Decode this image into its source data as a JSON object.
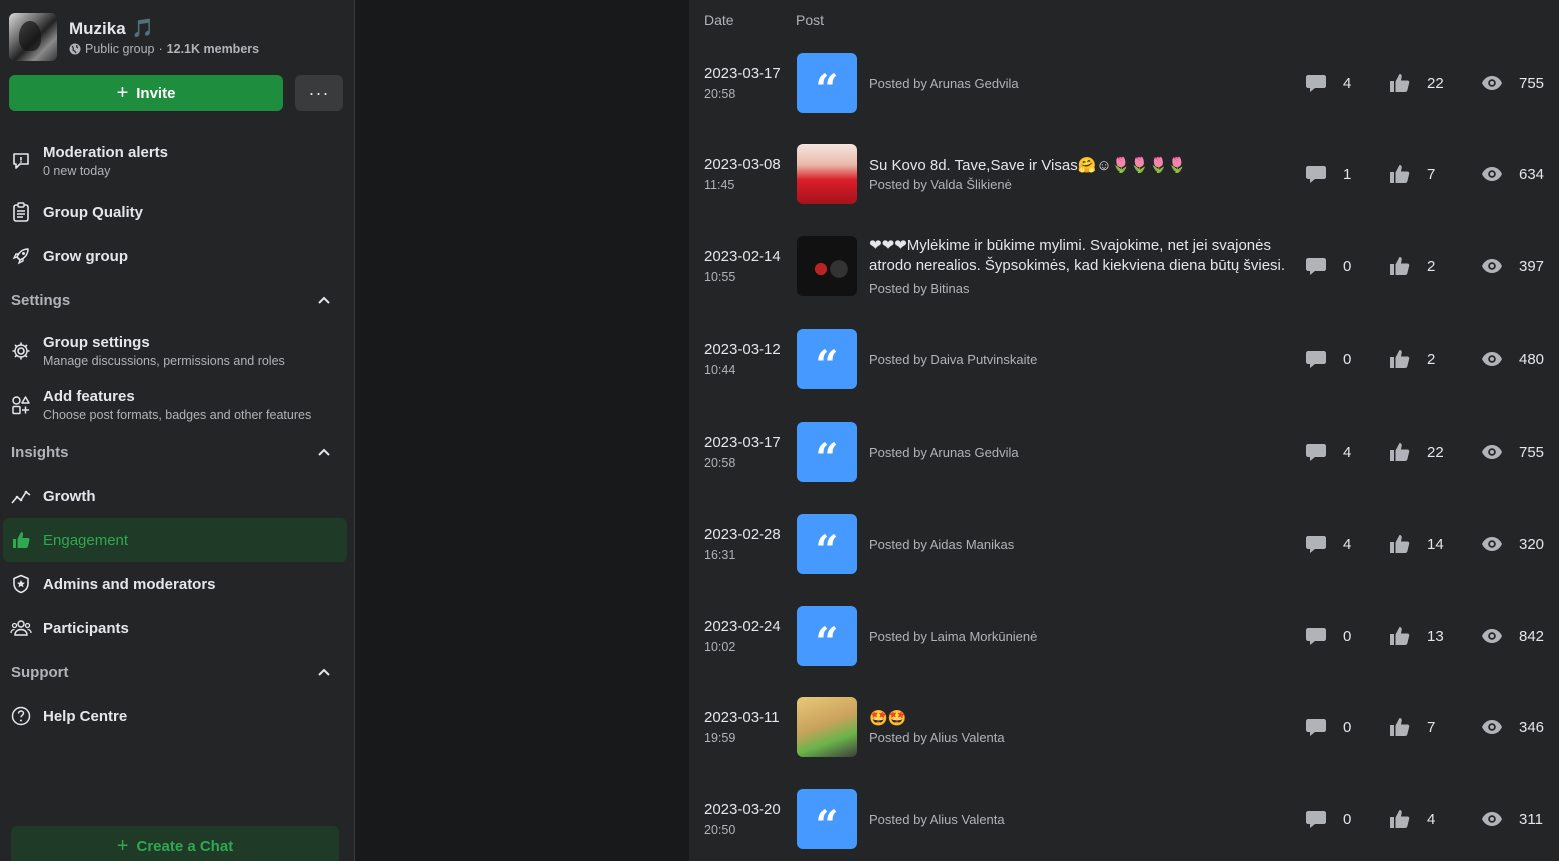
{
  "group": {
    "name": "Muzika",
    "emoji": "🎵",
    "privacy": "Public group",
    "separator": "·",
    "members": "12.1K members"
  },
  "buttons": {
    "invite": "Invite",
    "more": "···",
    "create_chat": "Create a Chat"
  },
  "nav": {
    "moderation_alerts": {
      "title": "Moderation alerts",
      "sub": "0 new today"
    },
    "group_quality": {
      "title": "Group Quality"
    },
    "grow_group": {
      "title": "Grow group"
    },
    "settings_header": "Settings",
    "group_settings": {
      "title": "Group settings",
      "sub": "Manage discussions, permissions and roles"
    },
    "add_features": {
      "title": "Add features",
      "sub": "Choose post formats, badges and other features"
    },
    "insights_header": "Insights",
    "growth": {
      "title": "Growth"
    },
    "engagement": {
      "title": "Engagement"
    },
    "admins": {
      "title": "Admins and moderators"
    },
    "participants": {
      "title": "Participants"
    },
    "support_header": "Support",
    "help_centre": {
      "title": "Help Centre"
    }
  },
  "table": {
    "col_date": "Date",
    "col_post": "Post",
    "rows": [
      {
        "date": "2023-03-17",
        "time": "20:58",
        "thumb": "quote",
        "title": "",
        "by": "Posted by Arunas Gedvila",
        "comments": "4",
        "likes": "22",
        "views": "755"
      },
      {
        "date": "2023-03-08",
        "time": "11:45",
        "thumb": "photo",
        "title": "Su Kovo 8d. Tave,Save ir Visas🤗☺🌷🌷🌷🌷",
        "by": "Posted by Valda Šlikienė",
        "comments": "1",
        "likes": "7",
        "views": "634"
      },
      {
        "date": "2023-02-14",
        "time": "10:55",
        "thumb": "photo",
        "title": "❤❤❤Mylėkime ir būkime mylimi. Svajokime, net jei svajonės atrodo nerealios. Šypsokimės, kad kiekviena diena būtų šviesi. O...",
        "by": "Posted by Bitinas",
        "comments": "0",
        "likes": "2",
        "views": "397"
      },
      {
        "date": "2023-03-12",
        "time": "10:44",
        "thumb": "quote",
        "title": "",
        "by": "Posted by Daiva Putvinskaite",
        "comments": "0",
        "likes": "2",
        "views": "480"
      },
      {
        "date": "2023-03-17",
        "time": "20:58",
        "thumb": "quote",
        "title": "",
        "by": "Posted by Arunas Gedvila",
        "comments": "4",
        "likes": "22",
        "views": "755"
      },
      {
        "date": "2023-02-28",
        "time": "16:31",
        "thumb": "quote",
        "title": "",
        "by": "Posted by Aidas Manikas",
        "comments": "4",
        "likes": "14",
        "views": "320"
      },
      {
        "date": "2023-02-24",
        "time": "10:02",
        "thumb": "quote",
        "title": "",
        "by": "Posted by Laima Morkūnienė",
        "comments": "0",
        "likes": "13",
        "views": "842"
      },
      {
        "date": "2023-03-11",
        "time": "19:59",
        "thumb": "photo",
        "title": "🤩🤩",
        "by": "Posted by Alius Valenta",
        "comments": "0",
        "likes": "7",
        "views": "346"
      },
      {
        "date": "2023-03-20",
        "time": "20:50",
        "thumb": "quote",
        "title": "",
        "by": "Posted by Alius Valenta",
        "comments": "0",
        "likes": "4",
        "views": "311"
      }
    ]
  },
  "quote_glyph": "“",
  "colors": {
    "accent_green": "#1e8e3e",
    "active_green_text": "#2fa84f",
    "quote_blue": "#4599ff",
    "panel_bg": "#242526"
  }
}
